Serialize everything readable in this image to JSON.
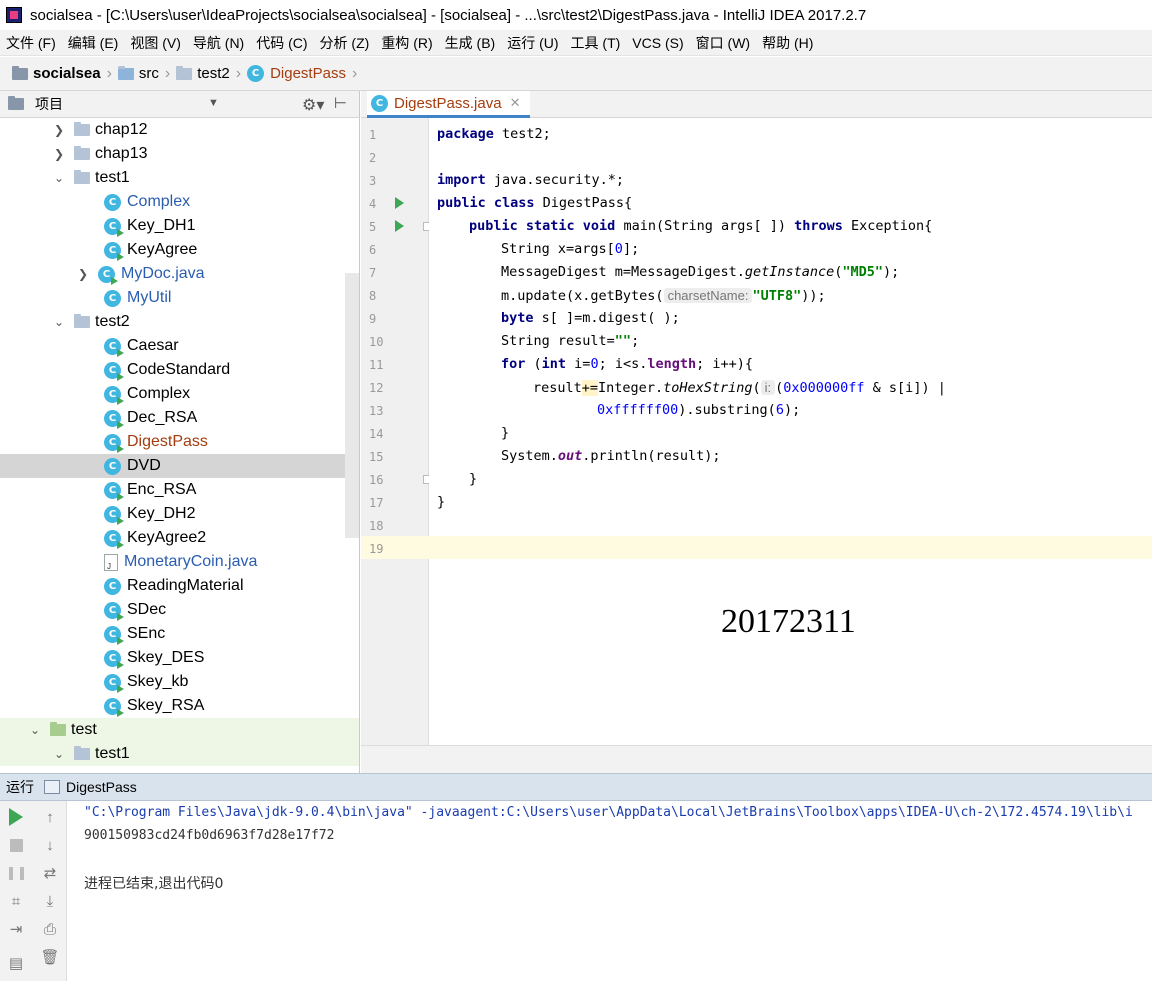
{
  "window": {
    "title": "socialsea - [C:\\Users\\user\\IdeaProjects\\socialsea\\socialsea] - [socialsea] - ...\\src\\test2\\DigestPass.java - IntelliJ IDEA 2017.2.7"
  },
  "menu": [
    "文件 (F)",
    "编辑 (E)",
    "视图 (V)",
    "导航 (N)",
    "代码 (C)",
    "分析 (Z)",
    "重构 (R)",
    "生成 (B)",
    "运行 (U)",
    "工具 (T)",
    "VCS (S)",
    "窗口 (W)",
    "帮助 (H)"
  ],
  "breadcrumb": {
    "project": "socialsea",
    "src": "src",
    "package": "test2",
    "file": "DigestPass"
  },
  "project_panel": {
    "title": "项目",
    "tree": {
      "chap12": "chap12",
      "chap13": "chap13",
      "test1": "test1",
      "test1_items": [
        "Complex",
        "Key_DH1",
        "KeyAgree",
        "MyDoc.java",
        "MyUtil"
      ],
      "test2": "test2",
      "test2_items": [
        "Caesar",
        "CodeStandard",
        "Complex",
        "Dec_RSA",
        "DigestPass",
        "DVD",
        "Enc_RSA",
        "Key_DH2",
        "KeyAgree2",
        "MonetaryCoin.java",
        "ReadingMaterial",
        "SDec",
        "SEnc",
        "Skey_DES",
        "Skey_kb",
        "Skey_RSA"
      ],
      "test": "test",
      "test_test1": "test1"
    }
  },
  "editor": {
    "tab_label": "DigestPass.java",
    "line_numbers": [
      "1",
      "2",
      "3",
      "4",
      "5",
      "6",
      "7",
      "8",
      "9",
      "10",
      "11",
      "12",
      "13",
      "14",
      "15",
      "16",
      "17",
      "18",
      "19"
    ],
    "code": {
      "l1_kw": "package",
      "l1_rest": " test2;",
      "l3_kw": "import",
      "l3_rest": " java.security.*;",
      "l4_kw": "public class",
      "l4_rest": " DigestPass{",
      "l5_kw1": "public static void",
      "l5_mid": " main(String args[ ]) ",
      "l5_kw2": "throws",
      "l5_rest": " Exception{",
      "l6_a": "String x=args[",
      "l6_num": "0",
      "l6_b": "];",
      "l7_a": "MessageDigest m=MessageDigest.",
      "l7_it": "getInstance",
      "l7_b": "(",
      "l7_str": "\"MD5\"",
      "l7_c": ");",
      "l8_a": "m.update(x.getBytes(",
      "l8_hint": "charsetName:",
      "l8_str": "\"UTF8\"",
      "l8_b": "));",
      "l9_kw": "byte",
      "l9_rest": " s[ ]=m.digest( );",
      "l10_a": "String result=",
      "l10_str": "\"\"",
      "l10_b": ";",
      "l11_kw1": "for",
      "l11_a": " (",
      "l11_kw2": "int",
      "l11_b": " i=",
      "l11_num": "0",
      "l11_c": "; i<s.",
      "l11_fld": "length",
      "l11_d": "; i++){",
      "l12_a": "result",
      "l12_op": "+=",
      "l12_b": "Integer.",
      "l12_it": "toHexString",
      "l12_c": "(",
      "l12_hint": "i:",
      "l12_d": "(",
      "l12_num": "0x000000ff",
      "l12_e": " & s[i]) |",
      "l13_num": "0xffffff00",
      "l13_a": ").substring(",
      "l13_num2": "6",
      "l13_b": ");",
      "l14": "}",
      "l15_a": "System.",
      "l15_fld": "out",
      "l15_b": ".println(result);",
      "l16": "}",
      "l17": "}"
    },
    "overlay_number": "20172311"
  },
  "run_panel": {
    "label": "运行",
    "tab": "DigestPass",
    "console": [
      "\"C:\\Program Files\\Java\\jdk-9.0.4\\bin\\java\" -javaagent:C:\\Users\\user\\AppData\\Local\\JetBrains\\Toolbox\\apps\\IDEA-U\\ch-2\\172.4574.19\\lib\\i",
      "900150983cd24fb0d6963f7d28e17f72",
      "",
      "进程已结束,退出代码0"
    ]
  },
  "colors": {
    "keyword": "#000080",
    "string": "#008000",
    "number": "#0000ff",
    "field": "#660e7a",
    "selected_file": "#a53d0e",
    "modified_file": "#2a5db0",
    "run_green": "#3da756"
  }
}
